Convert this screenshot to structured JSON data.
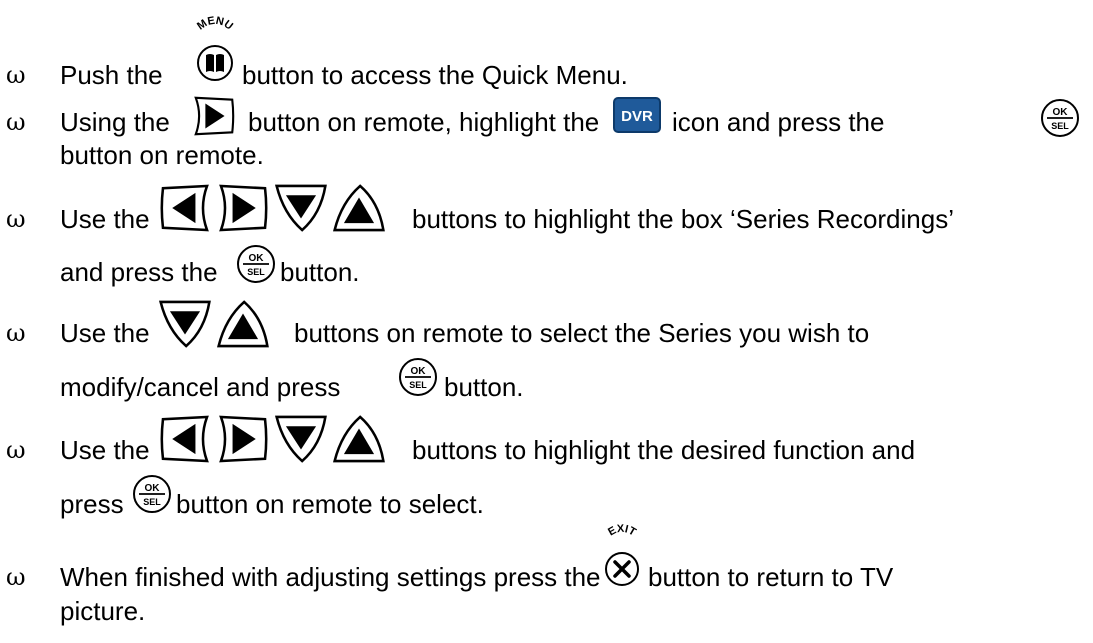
{
  "instructions": [
    {
      "parts": [
        "Push the",
        "button to access the Quick Menu."
      ],
      "icons": [
        "menu-button-icon"
      ]
    },
    {
      "parts": [
        "Using the",
        "button on remote, highlight the",
        "icon and press the",
        "button on remote."
      ],
      "icons": [
        "right-arrow-button-icon",
        "dvr-icon",
        "ok-sel-button-icon"
      ]
    },
    {
      "parts": [
        "Use the",
        "buttons to highlight the box ‘Series Recordings’",
        "and press the",
        "button."
      ],
      "icons": [
        "arrow-buttons-icon",
        "ok-sel-button-icon"
      ]
    },
    {
      "parts": [
        "Use the",
        "buttons on remote to select the Series you wish to",
        "modify/cancel and press",
        "button."
      ],
      "icons": [
        "up-down-buttons-icon",
        "ok-sel-button-icon"
      ]
    },
    {
      "parts": [
        "Use the",
        "buttons to highlight the desired function and",
        "press",
        "button on remote to select."
      ],
      "icons": [
        "arrow-buttons-icon",
        "ok-sel-button-icon"
      ]
    },
    {
      "parts": [
        "When finished with adjusting settings press the",
        "button to return to TV",
        "picture."
      ],
      "icons": [
        "exit-button-icon"
      ]
    }
  ],
  "bullet_symbol": "ω",
  "icon_labels": {
    "menu": "MENU",
    "dvr": "DVR",
    "ok": "OK",
    "sel": "SEL",
    "exit": "EXIT"
  },
  "colors": {
    "dvr_badge": "#1f5a9a",
    "text": "#000000"
  }
}
